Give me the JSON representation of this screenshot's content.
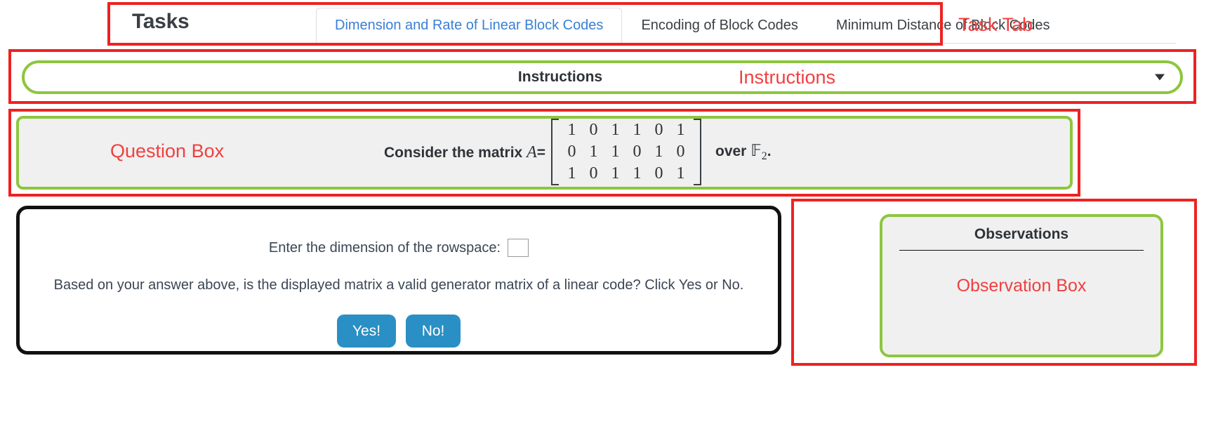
{
  "tabs_section": {
    "title": "Tasks",
    "tabs": [
      {
        "label": "Dimension and Rate of Linear Block Codes",
        "active": true
      },
      {
        "label": "Encoding of Block Codes",
        "active": false
      },
      {
        "label": "Minimum Distance of Block Codes",
        "active": false
      }
    ]
  },
  "instructions": {
    "label": "Instructions",
    "caret_icon": "chevron-down-icon"
  },
  "question": {
    "lead_text": "Consider the matrix",
    "matrix_name": "A",
    "equals": "=",
    "matrix": [
      [
        "1",
        "0",
        "1",
        "1",
        "0",
        "1"
      ],
      [
        "0",
        "1",
        "1",
        "0",
        "1",
        "0"
      ],
      [
        "1",
        "0",
        "1",
        "1",
        "0",
        "1"
      ]
    ],
    "over_text": "over",
    "field_symbol": "F",
    "field_subscript": "2",
    "trailing_period": "."
  },
  "answer": {
    "dimension_prompt": "Enter the dimension of the rowspace:",
    "dimension_value": "",
    "dimension_placeholder": "",
    "validity_question": "Based on your answer above, is the displayed matrix a valid generator matrix of a linear code? Click Yes or No.",
    "yes_label": "Yes!",
    "no_label": "No!"
  },
  "observations": {
    "title": "Observations",
    "body": ""
  },
  "annotations": {
    "task_tab": "Task Tab",
    "instructions": "Instructions",
    "question_box": "Question Box",
    "observation_box": "Observation Box"
  },
  "colors": {
    "annotation_red": "#ee2222",
    "annotation_text_red": "#f04040",
    "highlight_green": "#8dc63f",
    "active_tab_blue": "#3a7fd5",
    "button_blue": "#2a8fc4",
    "panel_gray": "#f0f0f0"
  }
}
